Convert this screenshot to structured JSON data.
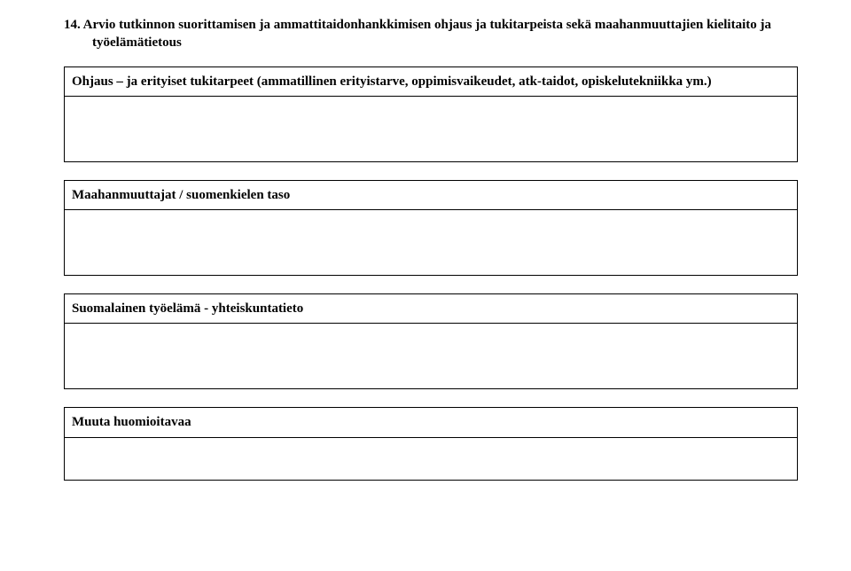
{
  "heading": {
    "line1": "14. Arvio tutkinnon suorittamisen ja ammattitaidonhankkimisen ohjaus ja tukitarpeista sekä maahanmuuttajien kielitaito ja",
    "line2": "työelämätietous"
  },
  "sections": {
    "s1": "Ohjaus – ja erityiset tukitarpeet (ammatillinen erityistarve, oppimisvaikeudet, atk-taidot, opiskelutekniikka ym.)",
    "s2": "Maahanmuuttajat / suomenkielen taso",
    "s3": "Suomalainen työelämä - yhteiskuntatieto",
    "s4": "Muuta huomioitavaa"
  }
}
